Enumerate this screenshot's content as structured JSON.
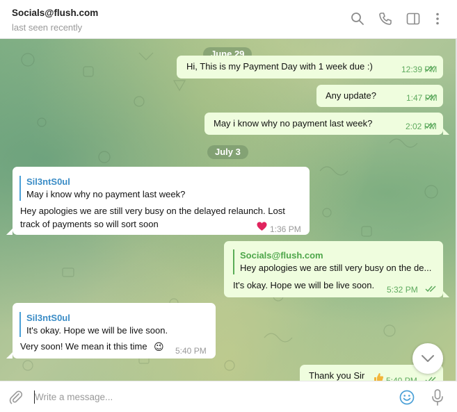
{
  "header": {
    "chat_name": "Socials@flush.com",
    "status": "last seen recently",
    "icons": [
      "search-icon",
      "phone-icon",
      "sidebar-toggle-icon",
      "more-vert-icon"
    ]
  },
  "dates": [
    {
      "label": "June 29"
    },
    {
      "label": "July 3"
    }
  ],
  "messages": [
    {
      "direction": "out",
      "text": "Hi, This is my Payment Day with 1 week due :)",
      "time": "12:39 PM",
      "read": true
    },
    {
      "direction": "out",
      "text": "Any update?",
      "time": "1:47 PM",
      "read": true
    },
    {
      "direction": "out",
      "text": "May i know why no payment last week?",
      "time": "2:02 PM",
      "read": true
    },
    {
      "direction": "in",
      "reply_to": {
        "name": "Sil3ntS0ul",
        "text": "May i know why no payment last week?"
      },
      "text_lines": [
        "Hey apologies we are still very busy on the delayed relaunch. Lost",
        "track of payments so will sort soon"
      ],
      "reaction": "heart",
      "time": "1:36 PM"
    },
    {
      "direction": "out",
      "reply_to": {
        "name": "Socials@flush.com",
        "text": "Hey apologies we are still very busy on the de..."
      },
      "text": "It's okay. Hope we will be live soon.",
      "time": "5:32 PM",
      "read": true
    },
    {
      "direction": "in",
      "reply_to": {
        "name": "Sil3ntS0ul",
        "text": "It's okay. Hope we will be live soon."
      },
      "text": "Very soon! We mean it this time",
      "emoji": "😉",
      "time": "5:40 PM"
    },
    {
      "direction": "out",
      "text": "Thank you Sir",
      "reaction": "thumbs-up",
      "time": "5:40 PM",
      "read": true
    }
  ],
  "composer": {
    "placeholder": "Write a message...",
    "value": "",
    "icons": [
      "attach-icon",
      "emoji-icon",
      "microphone-icon"
    ]
  },
  "colors": {
    "outgoing_bubble": "#effdde",
    "incoming_bubble": "#ffffff",
    "read_check": "#5eaa5e",
    "reply_accent_in": "#4aa0d7",
    "reply_accent_out": "#5aad56"
  }
}
